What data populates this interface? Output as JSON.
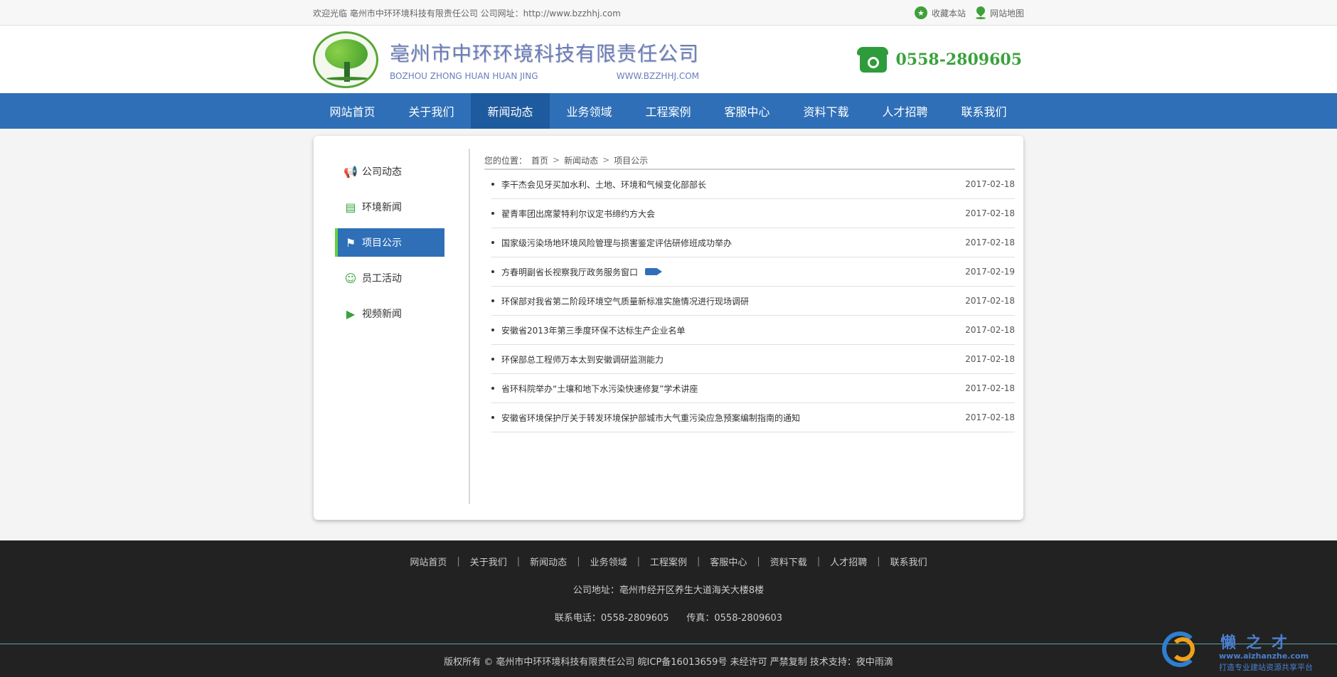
{
  "topbar": {
    "welcome": "欢迎光临 亳州市中环环境科技有限责任公司 公司网址：http://www.bzzhhj.com",
    "favorite": "收藏本站",
    "sitemap": "网站地图"
  },
  "header": {
    "company_cn": "亳州市中环环境科技有限责任公司",
    "company_en": "BOZHOU ZHONG HUAN HUAN JING",
    "domain": "WWW.BZZHHJ.COM",
    "phone": "0558-2809605"
  },
  "nav": {
    "items": [
      {
        "label": "网站首页"
      },
      {
        "label": "关于我们"
      },
      {
        "label": "新闻动态"
      },
      {
        "label": "业务领域"
      },
      {
        "label": "工程案例"
      },
      {
        "label": "客服中心"
      },
      {
        "label": "资料下载"
      },
      {
        "label": "人才招聘"
      },
      {
        "label": "联系我们"
      }
    ],
    "active": "新闻动态"
  },
  "sidebar": {
    "items": [
      {
        "label": "公司动态",
        "icon": "megaphone-icon"
      },
      {
        "label": "环境新闻",
        "icon": "newspaper-icon"
      },
      {
        "label": "项目公示",
        "icon": "project-icon"
      },
      {
        "label": "员工活动",
        "icon": "people-icon"
      },
      {
        "label": "视频新闻",
        "icon": "video-icon"
      }
    ],
    "active": "项目公示"
  },
  "breadcrumb": {
    "prefix": "您的位置：",
    "items": [
      "首页",
      "新闻动态",
      "项目公示"
    ],
    "sep": ">"
  },
  "news": [
    {
      "title": "李干杰会见牙买加水利、土地、环境和气候变化部部长",
      "date": "2017-02-18"
    },
    {
      "title": "翟青率团出席蒙特利尔议定书缔约方大会",
      "date": "2017-02-18"
    },
    {
      "title": "国家级污染场地环境风险管理与损害鉴定评估研修班成功举办",
      "date": "2017-02-18"
    },
    {
      "title": "方春明副省长视察我厅政务服务窗口",
      "date": "2017-02-19"
    },
    {
      "title": "环保部对我省第二阶段环境空气质量新标准实施情况进行现场调研",
      "date": "2017-02-18"
    },
    {
      "title": "安徽省2013年第三季度环保不达标生产企业名单",
      "date": "2017-02-18"
    },
    {
      "title": "环保部总工程师万本太到安徽调研监测能力",
      "date": "2017-02-18"
    },
    {
      "title": "省环科院举办“土壤和地下水污染快速修复”学术讲座",
      "date": "2017-02-18"
    },
    {
      "title": "安徽省环境保护厅关于转发环境保护部城市大气重污染应急预案编制指南的通知",
      "date": "2017-02-18"
    }
  ],
  "footer": {
    "links": [
      "网站首页",
      "关于我们",
      "新闻动态",
      "业务领域",
      "工程案例",
      "客服中心",
      "资料下载",
      "人才招聘",
      "联系我们"
    ],
    "address": "公司地址：亳州市经开区养生大道海关大楼8楼",
    "phone": "联系电话：0558-2809605",
    "fax": "传真：0558-2809603",
    "copyright": "版权所有 ©   亳州市中环环境科技有限责任公司   皖ICP备16013659号   未经许可 严禁复制   技术支持：夜中雨滴"
  },
  "watermark": {
    "title": "懒之才",
    "url": "www.aizhanzhe.com",
    "sub": "打造专业建站资源共享平台"
  },
  "colors": {
    "nav_bg": "#2f6fb7",
    "nav_active": "#1e5a9e",
    "accent_green": "#3aa23c",
    "footer_bg": "#222222"
  }
}
